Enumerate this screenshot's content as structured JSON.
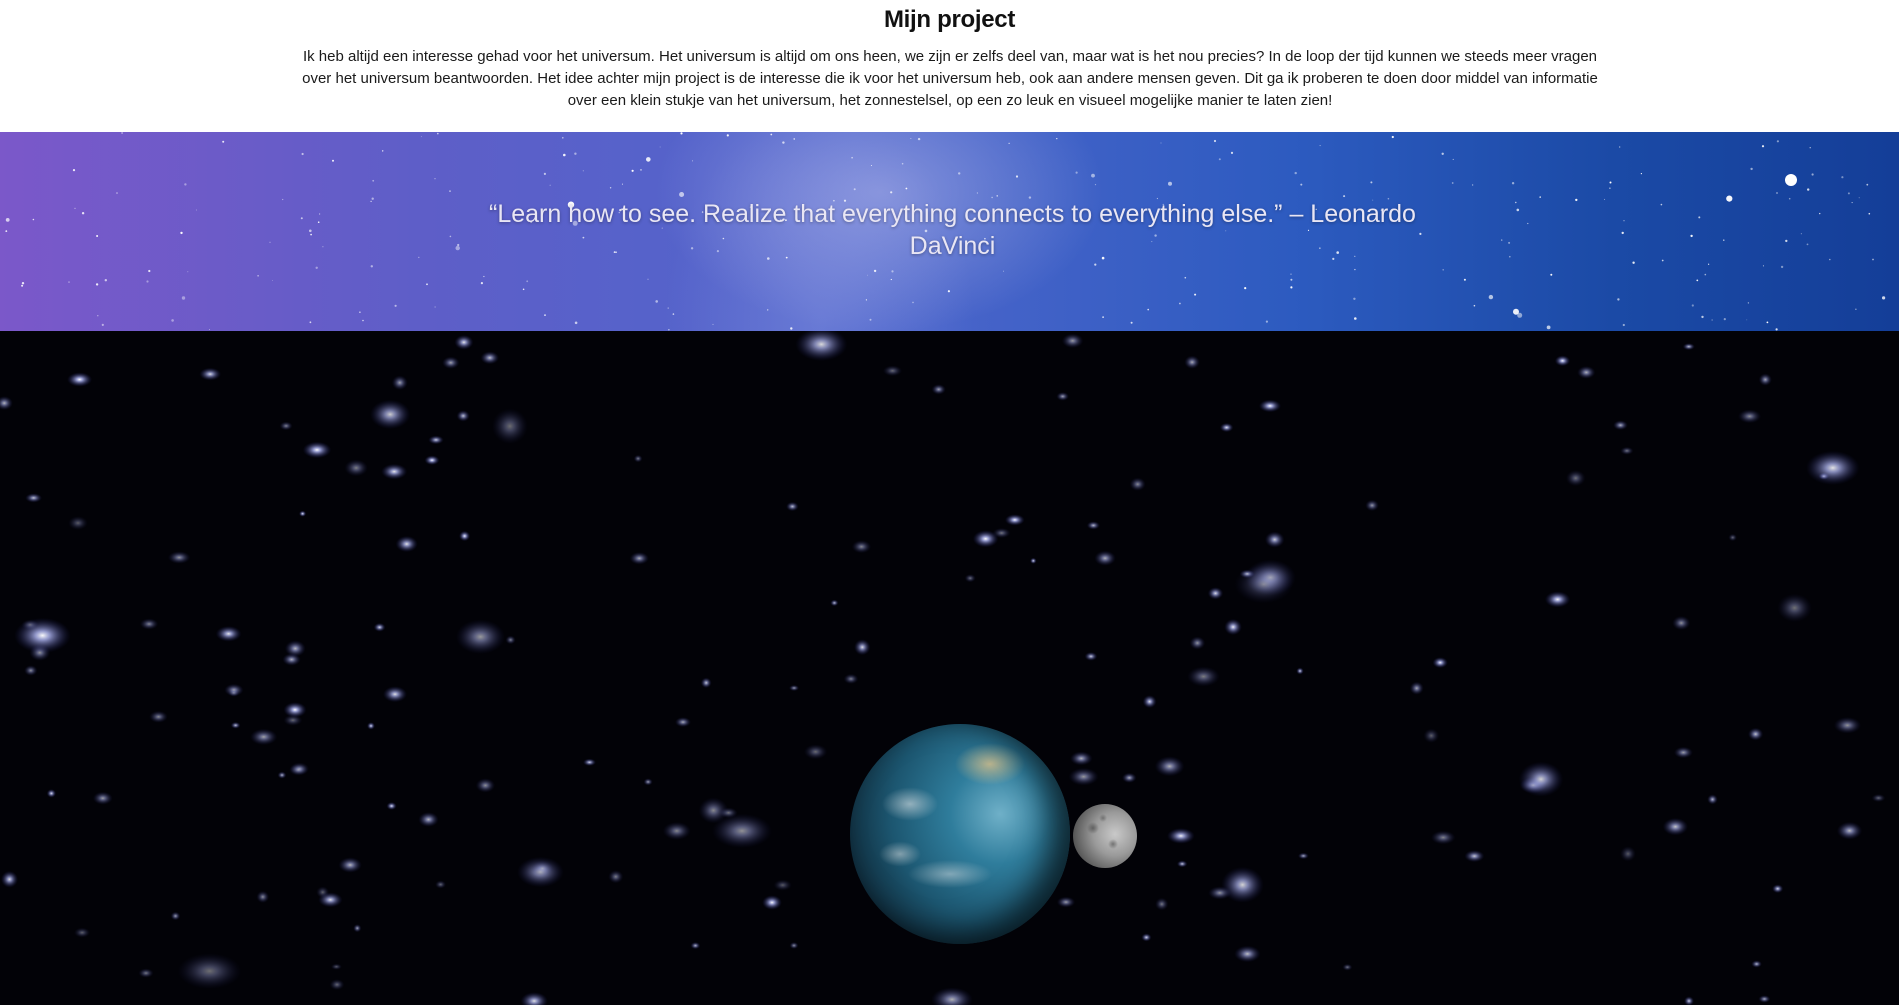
{
  "intro": {
    "title": "Mijn project",
    "body": "Ik heb altijd een interesse gehad voor het universum. Het universum is altijd om ons heen, we zijn er zelfs deel van, maar wat is het nou precies? In de loop der tijd kunnen we steeds meer vragen over het universum beantwoorden. Het idee achter mijn project is de interesse die ik voor het universum heb, ook aan andere mensen geven. Dit ga ik proberen te doen door middel van informatie over een klein stukje van het universum, het zonnestelsel, op een zo leuk en visueel mogelijke manier te laten zien!"
  },
  "quote": {
    "text": "“Learn how to see. Realize that everything connects to everything else.” – Leonardo DaVinci"
  },
  "scene": {
    "bodies": [
      "earth",
      "moon"
    ],
    "background_color": "#020207"
  }
}
